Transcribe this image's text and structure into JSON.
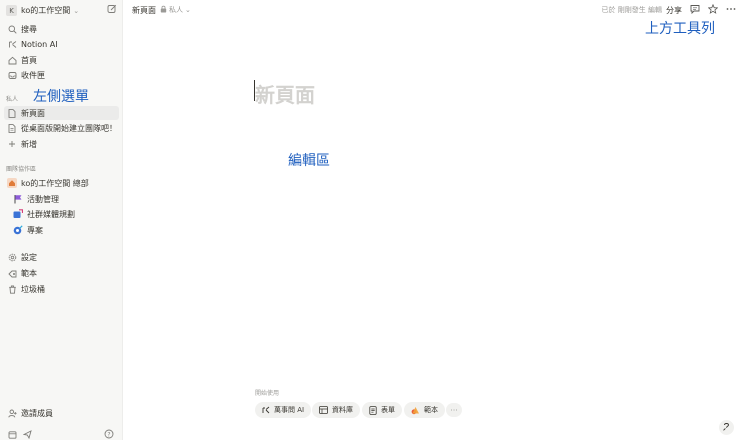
{
  "workspace": {
    "avatar_letter": "K",
    "name": "ko的工作空間"
  },
  "sidebar": {
    "top_items": [
      {
        "label": "搜尋",
        "icon": "search-icon"
      },
      {
        "label": "Notion AI",
        "icon": "notion-ai-icon"
      },
      {
        "label": "首頁",
        "icon": "home-icon"
      },
      {
        "label": "收件匣",
        "icon": "inbox-icon"
      }
    ],
    "private_section": "私人",
    "private_items": [
      {
        "label": "新頁面",
        "icon": "page-icon",
        "active": true
      },
      {
        "label": "從桌面版開始建立團隊吧！",
        "icon": "page-icon"
      },
      {
        "label": "新增",
        "icon": "plus-icon"
      }
    ],
    "team_section": "團隊協作區",
    "team_items": [
      {
        "label": "ko的工作空間 總部",
        "icon": "home-orange-icon"
      },
      {
        "label": "活動管理",
        "icon": "flag-icon"
      },
      {
        "label": "社群媒體規劃",
        "icon": "social-icon"
      },
      {
        "label": "專案",
        "icon": "target-icon"
      }
    ],
    "bottom_items": [
      {
        "label": "設定",
        "icon": "gear-icon"
      },
      {
        "label": "範本",
        "icon": "template-icon"
      },
      {
        "label": "垃圾桶",
        "icon": "trash-icon"
      }
    ],
    "invite_label": "邀請成員"
  },
  "topbar": {
    "page_title": "新頁面",
    "privacy": "私人",
    "edited": "已於 剛剛發生 編輯",
    "share": "分享"
  },
  "editor": {
    "title_placeholder": "新頁面",
    "start_label": "開始使用",
    "chips": [
      {
        "label": "萬事問 AI",
        "icon": "ai-icon"
      },
      {
        "label": "資料庫",
        "icon": "table-icon"
      },
      {
        "label": "表單",
        "icon": "form-icon"
      },
      {
        "label": "範本",
        "icon": "template-color-icon"
      }
    ],
    "more": "···"
  },
  "annotations": {
    "sidebar": "左側選單",
    "toolbar": "上方工具列",
    "editor": "編輯區"
  },
  "colors": {
    "annotation": "#1f5fbf",
    "sidebar_bg": "#f7f7f5",
    "active_bg": "#ebebea"
  }
}
